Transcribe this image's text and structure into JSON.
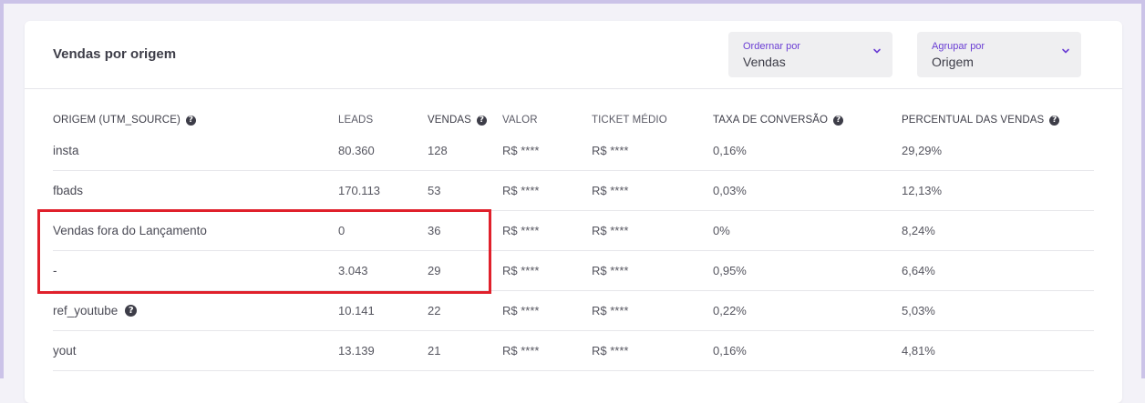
{
  "card": {
    "title": "Vendas por origem",
    "order_select": {
      "label": "Ordernar por",
      "value": "Vendas"
    },
    "group_select": {
      "label": "Agrupar por",
      "value": "Origem"
    }
  },
  "table": {
    "headers": {
      "origin": "ORIGEM (UTM_SOURCE)",
      "leads": "LEADS",
      "sales": "VENDAS",
      "value": "VALOR",
      "ticket": "TICKET MÉDIO",
      "conversion": "TAXA DE CONVERSÃO",
      "percent": "PERCENTUAL DAS VENDAS"
    },
    "rows": [
      {
        "origin": "insta",
        "leads": "80.360",
        "sales": "128",
        "value": "R$ ****",
        "ticket": "R$ ****",
        "conversion": "0,16%",
        "percent": "29,29%"
      },
      {
        "origin": "fbads",
        "leads": "170.113",
        "sales": "53",
        "value": "R$ ****",
        "ticket": "R$ ****",
        "conversion": "0,03%",
        "percent": "12,13%"
      },
      {
        "origin": "Vendas fora do Lançamento",
        "leads": "0",
        "sales": "36",
        "value": "R$ ****",
        "ticket": "R$ ****",
        "conversion": "0%",
        "percent": "8,24%"
      },
      {
        "origin": "-",
        "leads": "3.043",
        "sales": "29",
        "value": "R$ ****",
        "ticket": "R$ ****",
        "conversion": "0,95%",
        "percent": "6,64%"
      },
      {
        "origin": "ref_youtube",
        "leads": "10.141",
        "sales": "22",
        "value": "R$ ****",
        "ticket": "R$ ****",
        "conversion": "0,22%",
        "percent": "5,03%"
      },
      {
        "origin": "yout",
        "leads": "13.139",
        "sales": "21",
        "value": "R$ ****",
        "ticket": "R$ ****",
        "conversion": "0,16%",
        "percent": "4,81%"
      }
    ]
  },
  "colors": {
    "accent": "#6b3fd4",
    "highlight": "#e0202b",
    "frame": "#cbc3e8"
  },
  "icons": {
    "help": "question-circle-icon",
    "chevron": "chevron-down-icon"
  }
}
